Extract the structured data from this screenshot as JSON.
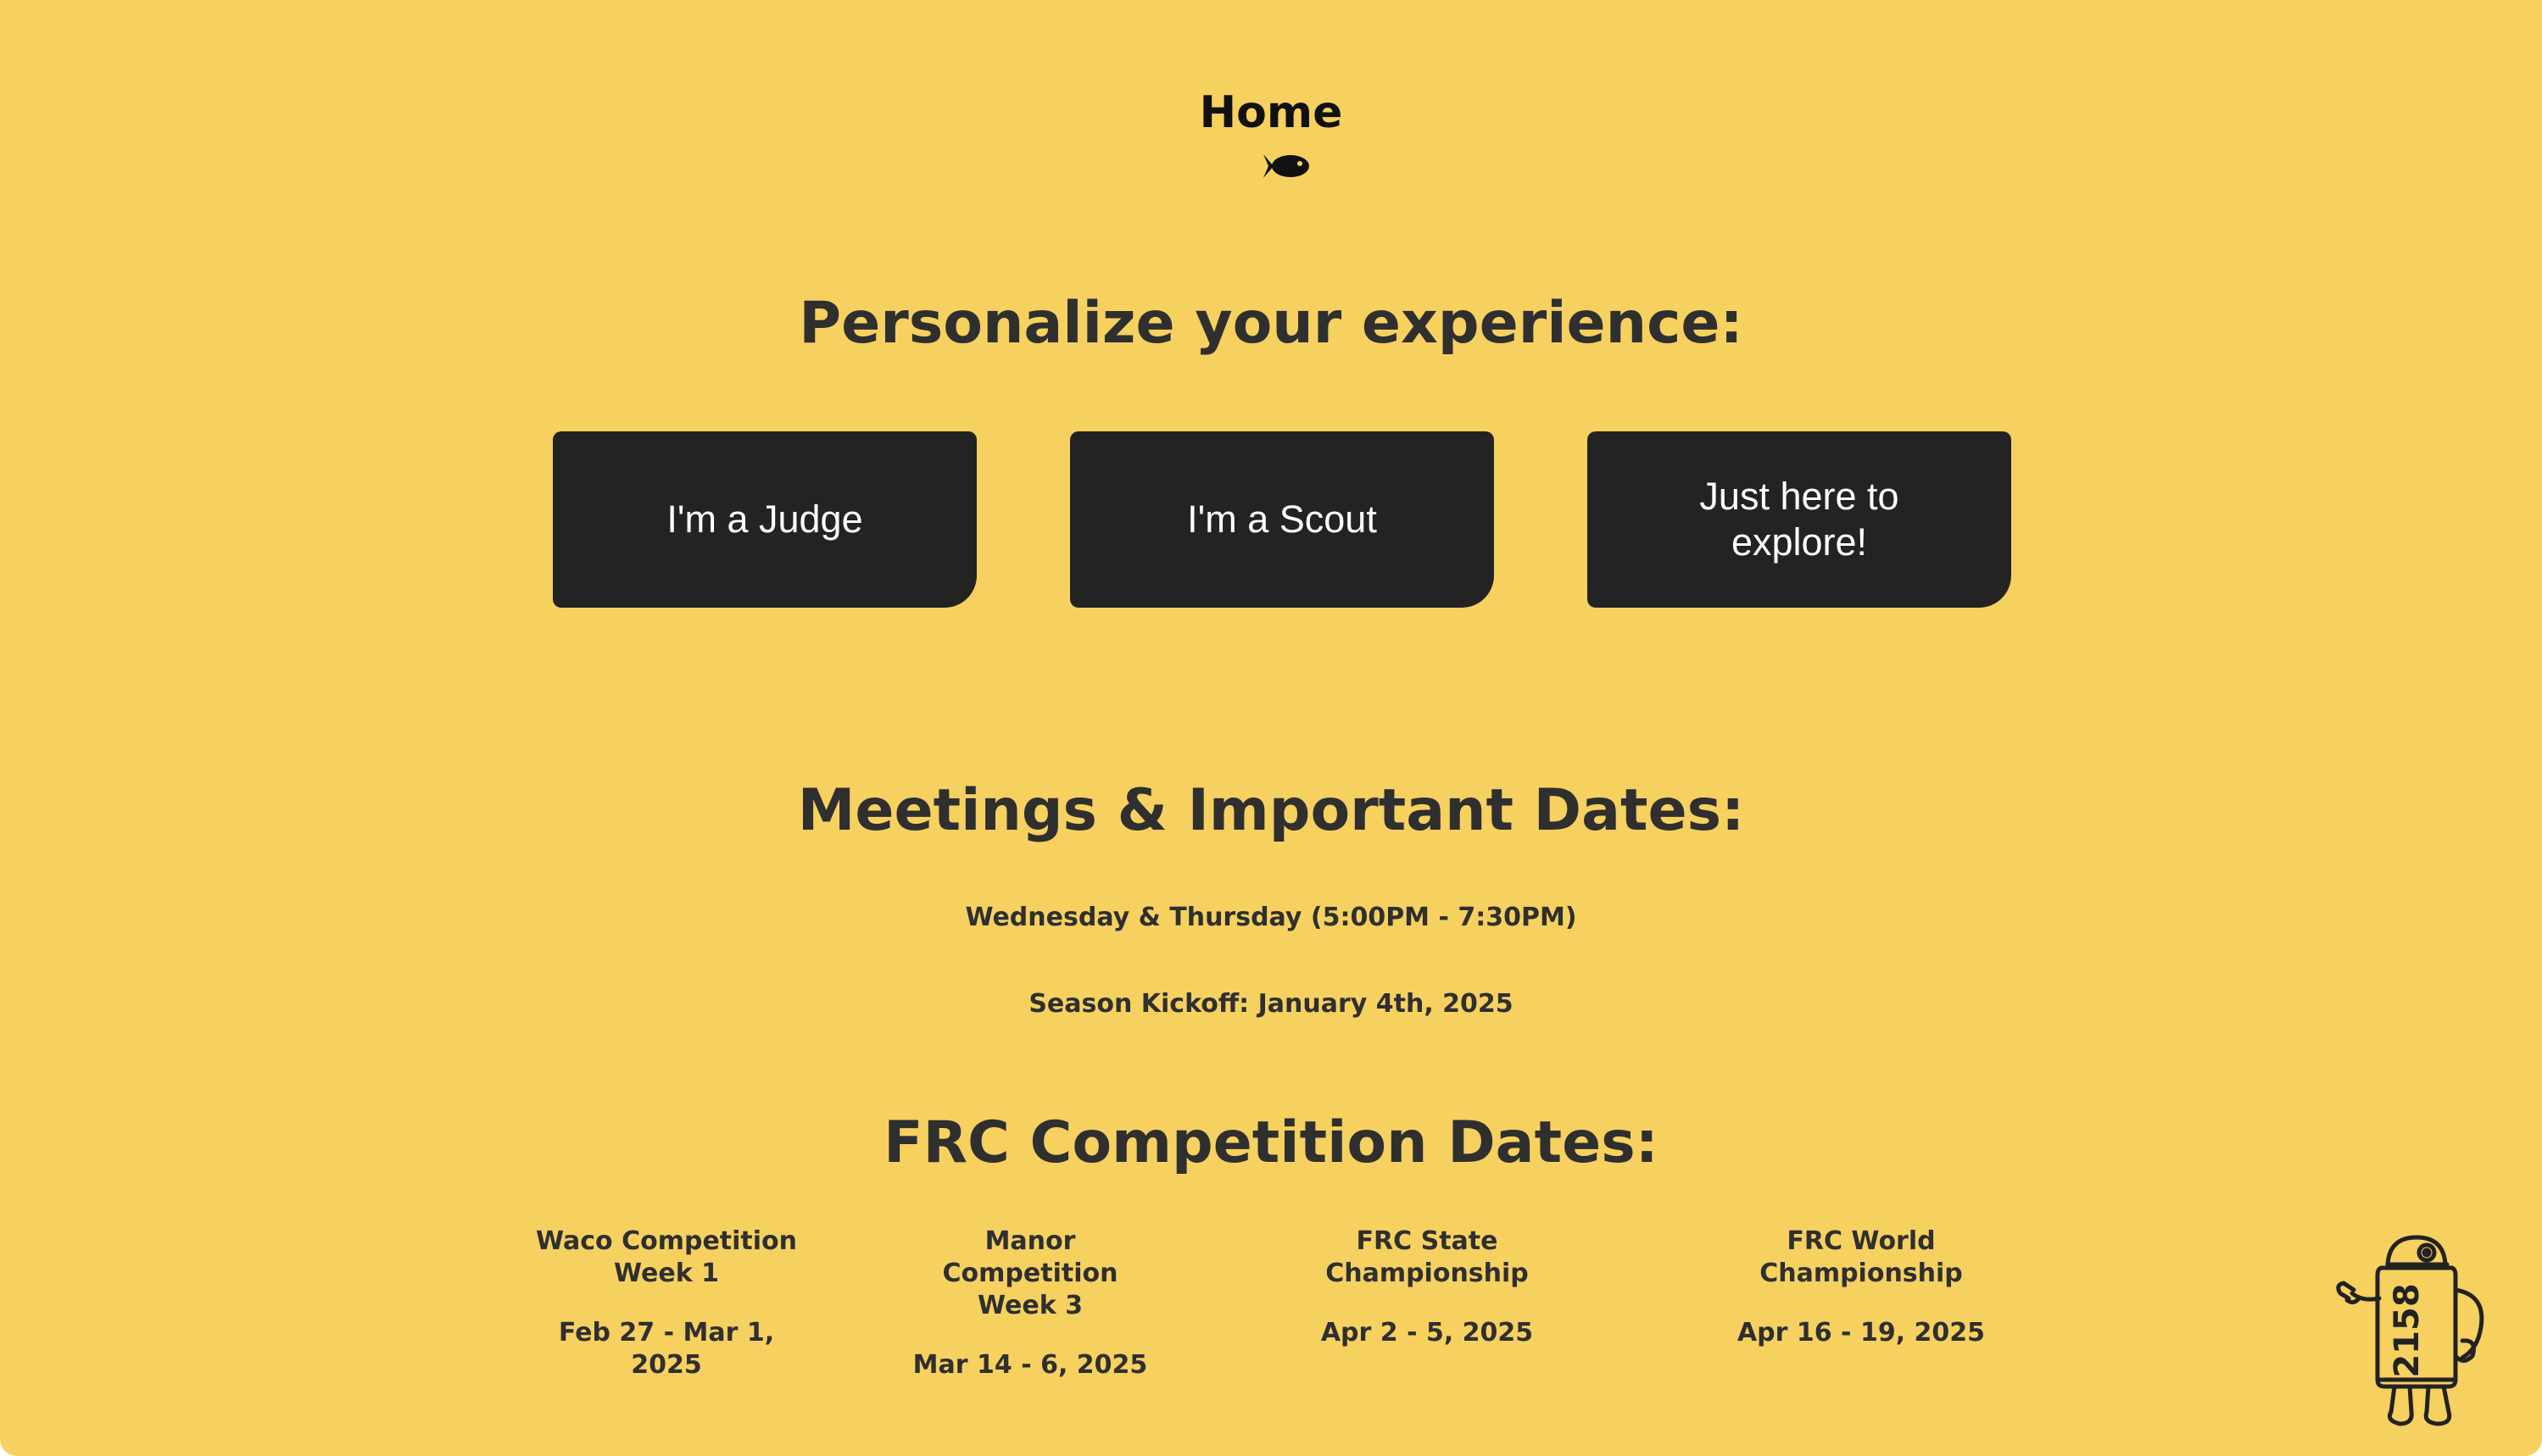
{
  "header": {
    "title": "Home",
    "icon": "fish-icon"
  },
  "personalize": {
    "heading": "Personalize your experience:",
    "buttons": [
      {
        "label": "I'm a Judge"
      },
      {
        "label": "I'm a Scout"
      },
      {
        "label": "Just here to explore!"
      }
    ]
  },
  "meetings": {
    "heading": "Meetings & Important Dates:",
    "lines": [
      "Wednesday & Thursday (5:00PM - 7:30PM)",
      "Season Kickoff: January 4th, 2025"
    ]
  },
  "competitions": {
    "heading": "FRC Competition Dates:",
    "items": [
      {
        "name": "Waco Competition\nWeek 1",
        "date": "Feb 27 - Mar 1, 2025"
      },
      {
        "name": "Manor Competition\nWeek 3",
        "date": "Mar 14 - 6, 2025"
      },
      {
        "name": "FRC State Championship",
        "date": "Apr 2 - 5, 2025"
      },
      {
        "name": "FRC World Championship",
        "date": "Apr 16 - 19, 2025"
      }
    ]
  },
  "mascot": {
    "label": "2158",
    "icon": "robot-mascot-icon"
  },
  "colors": {
    "background": "#F6D160",
    "button": "#232323",
    "button_text": "#FFFFFF",
    "text": "#2F2F2F"
  }
}
